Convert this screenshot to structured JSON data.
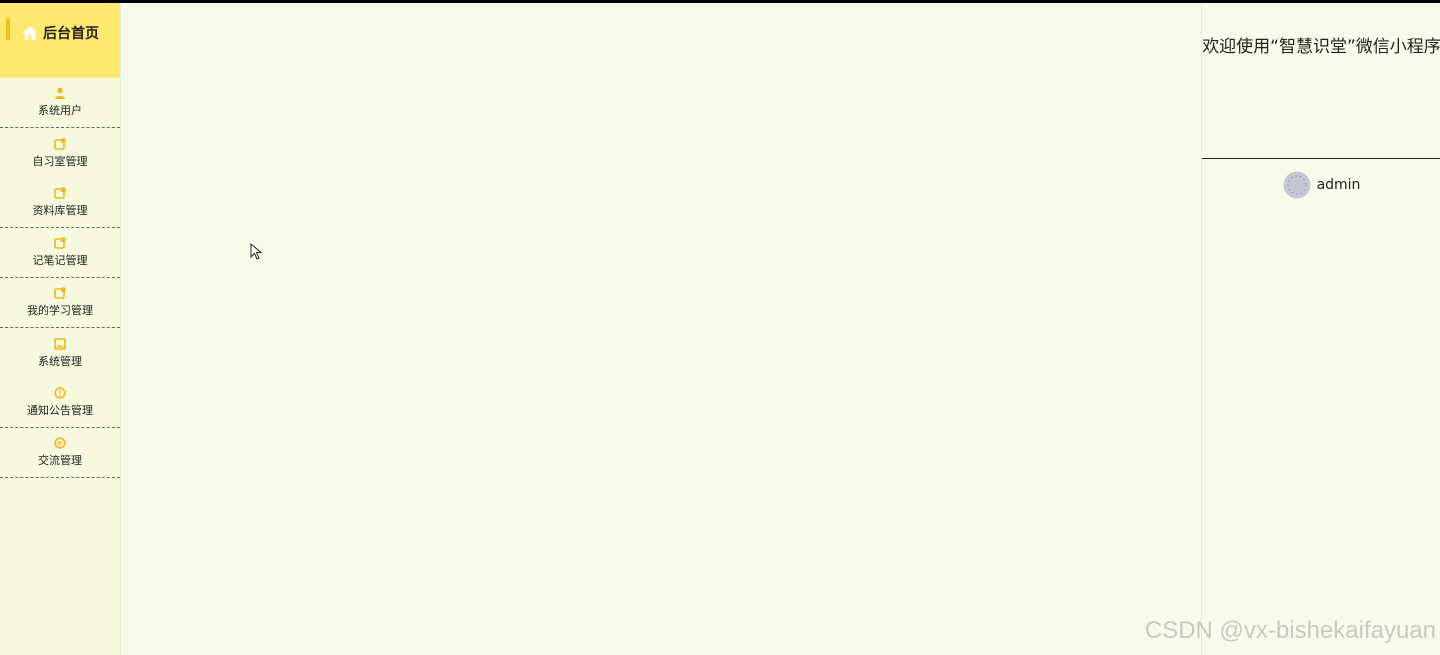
{
  "sidebar": {
    "home_label": "后台首页",
    "items": [
      {
        "label": "系统用户",
        "icon": "user-icon"
      },
      {
        "label": "自习室管理",
        "icon": "edit-icon"
      },
      {
        "label": "资料库管理",
        "icon": "edit-icon"
      },
      {
        "label": "记笔记管理",
        "icon": "edit-icon"
      },
      {
        "label": "我的学习管理",
        "icon": "edit-icon"
      },
      {
        "label": "系统管理",
        "icon": "image-icon"
      },
      {
        "label": "通知公告管理",
        "icon": "alert-icon"
      },
      {
        "label": "交流管理",
        "icon": "chat-icon"
      }
    ]
  },
  "header": {
    "welcome": "欢迎使用“智慧识堂”微信小程序",
    "username": "admin"
  },
  "watermark": "CSDN @vx-bishekaifayuan",
  "colors": {
    "accent": "#ffe870",
    "icon": "#f3b51a",
    "page_bg": "#f8fbea",
    "sidebar_bg": "#f6f9dd"
  }
}
